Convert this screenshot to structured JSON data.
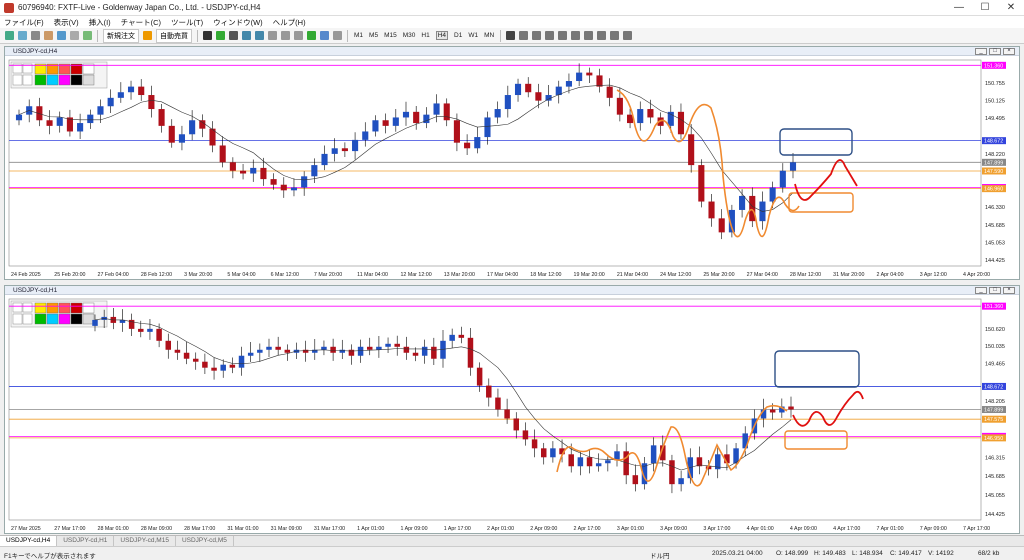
{
  "window": {
    "title": "60796940: FXTF-Live - Goldenway Japan Co., Ltd. - USDJPY-cd,H4",
    "min": "—",
    "max": "☐",
    "close": "✕"
  },
  "menu": [
    "ファイル(F)",
    "表示(V)",
    "挿入(I)",
    "チャート(C)",
    "ツール(T)",
    "ウィンドウ(W)",
    "ヘルプ(H)"
  ],
  "toolbar": {
    "new_order": "新規注文",
    "auto_trade": "自動売買",
    "timeframes": [
      "M1",
      "M5",
      "M15",
      "M30",
      "H1",
      "H4",
      "D1",
      "W1",
      "MN"
    ],
    "active_tf": "H4"
  },
  "chart_data": [
    {
      "type": "candlestick",
      "title": "USDJPY-cd,H4",
      "symbol": "USDJPY-cd,H4",
      "y_ticks": [
        "151.360",
        "150.755",
        "150.125",
        "149.495",
        "148.672",
        "148.220",
        "147.899",
        "147.590",
        "147.000",
        "146.960",
        "146.330",
        "145.685",
        "145.053",
        "144.425"
      ],
      "x_ticks": [
        "24 Feb 2025",
        "25 Feb 20:00",
        "27 Feb 04:00",
        "28 Feb 12:00",
        "3 Mar 20:00",
        "5 Mar 04:00",
        "6 Mar 12:00",
        "7 Mar 20:00",
        "11 Mar 04:00",
        "12 Mar 12:00",
        "13 Mar 20:00",
        "17 Mar 04:00",
        "18 Mar 12:00",
        "19 Mar 20:00",
        "21 Mar 04:00",
        "24 Mar 12:00",
        "25 Mar 20:00",
        "27 Mar 04:00",
        "28 Mar 12:00",
        "31 Mar 20:00",
        "2 Apr 04:00",
        "3 Apr 12:00",
        "4 Apr 20:00"
      ],
      "hlines": [
        {
          "label": "151.360",
          "price": 151.36,
          "color": "#ff00ff"
        },
        {
          "label": "148.672",
          "price": 148.672,
          "color": "#3344dd"
        },
        {
          "label": "147.899",
          "price": 147.899,
          "color": "#888888"
        },
        {
          "label": "147.590",
          "price": 147.59,
          "color": "#f0a030"
        },
        {
          "label": "147.000",
          "price": 147.0,
          "color": "#ff00ff"
        },
        {
          "label": "146.960",
          "price": 146.96,
          "color": "#f0a030"
        }
      ],
      "close_series": [
        149.6,
        149.9,
        149.4,
        149.2,
        149.5,
        149.0,
        149.3,
        149.6,
        149.9,
        150.2,
        150.4,
        150.6,
        150.3,
        149.8,
        149.2,
        148.6,
        148.9,
        149.4,
        149.1,
        148.5,
        147.9,
        147.6,
        147.5,
        147.7,
        147.3,
        147.1,
        146.9,
        147.0,
        147.4,
        147.8,
        148.2,
        148.4,
        148.3,
        148.7,
        149.0,
        149.4,
        149.2,
        149.5,
        149.7,
        149.3,
        149.6,
        150.0,
        149.4,
        148.6,
        148.4,
        148.8,
        149.5,
        149.8,
        150.3,
        150.7,
        150.4,
        150.1,
        150.3,
        150.6,
        150.8,
        151.1,
        151.0,
        150.6,
        150.2,
        149.6,
        149.3,
        149.8,
        149.5,
        149.2,
        149.7,
        148.9,
        147.8,
        146.5,
        145.9,
        145.4,
        146.2,
        146.7,
        145.8,
        146.5,
        147.0,
        147.6,
        147.9
      ],
      "annotations": [
        "orange wave path",
        "blue rounded box",
        "orange rounded box",
        "red projected path"
      ]
    },
    {
      "type": "candlestick",
      "title": "USDJPY-cd,H1",
      "symbol": "USDJPY-cd,H1",
      "y_ticks": [
        "151.360",
        "150.620",
        "150.035",
        "149.465",
        "148.672",
        "148.205",
        "147.899",
        "147.575",
        "147.000",
        "146.950",
        "146.315",
        "145.685",
        "145.055",
        "144.425"
      ],
      "x_ticks": [
        "27 Mar 2025",
        "27 Mar 17:00",
        "28 Mar 01:00",
        "28 Mar 09:00",
        "28 Mar 17:00",
        "31 Mar 01:00",
        "31 Mar 09:00",
        "31 Mar 17:00",
        "1 Apr 01:00",
        "1 Apr 09:00",
        "1 Apr 17:00",
        "2 Apr 01:00",
        "2 Apr 09:00",
        "2 Apr 17:00",
        "3 Apr 01:00",
        "3 Apr 09:00",
        "3 Apr 17:00",
        "4 Apr 01:00",
        "4 Apr 09:00",
        "4 Apr 17:00",
        "7 Apr 01:00",
        "7 Apr 09:00",
        "7 Apr 17:00"
      ],
      "hlines": [
        {
          "label": "151.360",
          "price": 151.36,
          "color": "#ff00ff"
        },
        {
          "label": "148.672",
          "price": 148.672,
          "color": "#3344dd"
        },
        {
          "label": "147.899",
          "price": 147.899,
          "color": "#888888"
        },
        {
          "label": "147.575",
          "price": 147.575,
          "color": "#f0a030"
        },
        {
          "label": "147.000",
          "price": 147.0,
          "color": "#ff00ff"
        },
        {
          "label": "146.950",
          "price": 146.95,
          "color": "#f0a030"
        }
      ],
      "close_series": [
        150.9,
        151.0,
        150.8,
        150.9,
        150.6,
        150.5,
        150.6,
        150.2,
        149.9,
        149.8,
        149.6,
        149.5,
        149.3,
        149.2,
        149.4,
        149.3,
        149.7,
        149.8,
        149.9,
        150.0,
        149.9,
        149.8,
        149.9,
        149.8,
        149.9,
        150.0,
        149.8,
        149.9,
        149.7,
        150.0,
        149.9,
        150.0,
        150.1,
        150.0,
        149.8,
        149.7,
        150.0,
        149.6,
        150.2,
        150.4,
        150.3,
        149.3,
        148.7,
        148.3,
        147.9,
        147.6,
        147.2,
        146.9,
        146.6,
        146.3,
        146.6,
        146.4,
        146.0,
        146.3,
        146.0,
        146.1,
        146.2,
        146.5,
        145.7,
        145.4,
        146.1,
        146.7,
        146.2,
        145.4,
        145.6,
        146.3,
        146.0,
        145.9,
        146.4,
        146.1,
        146.6,
        147.1,
        147.6,
        147.9,
        147.8,
        148.0,
        147.9
      ],
      "annotations": [
        "orange wave path",
        "blue rounded box",
        "orange rounded box",
        "red projected path"
      ]
    }
  ],
  "price_tags": [
    "151.360",
    "148.672",
    "147.899",
    "147.590",
    "147.000",
    "146.960"
  ],
  "tabs": [
    "USDJPY-cd,H4",
    "USDJPY-cd,H1",
    "USDJPY-cd,M15",
    "USDJPY-cd,M5"
  ],
  "status": {
    "help": "F1キーでヘルプが表示されます",
    "group": "ドル円",
    "time": "2025.03.21 04:00",
    "open": "O: 148.999",
    "high": "H: 149.483",
    "low": "L: 148.934",
    "close": "C: 149.417",
    "volume": "V: 14192",
    "traffic": "68/2 kb"
  }
}
